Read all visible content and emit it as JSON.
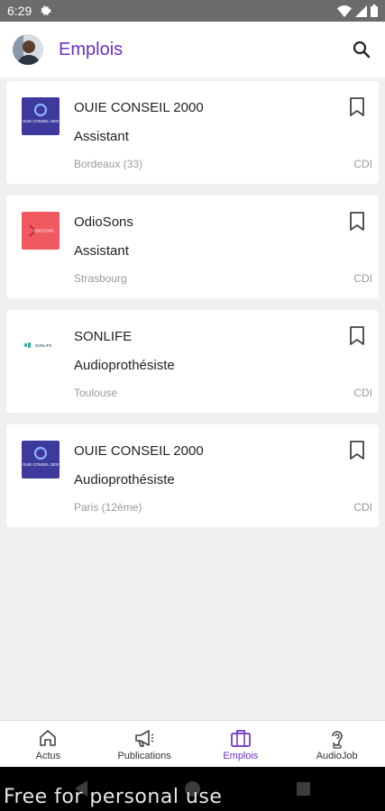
{
  "status_bar": {
    "time": "6:29",
    "icons": [
      "settings-icon",
      "wifi-icon",
      "signal-icon",
      "battery-icon"
    ]
  },
  "app_bar": {
    "title": "Emplois",
    "search_icon": "search-icon",
    "accent_color": "#6a2fc9"
  },
  "jobs": [
    {
      "company": "OUIE CONSEIL 2000",
      "title": "Assistant",
      "location": "Bordeaux (33)",
      "contract": "CDI",
      "logo": {
        "text": "OUIE CONSEIL 2000",
        "bg": "#3d3a9c"
      }
    },
    {
      "company": "OdioSons",
      "title": "Assistant",
      "location": "Strasbourg",
      "contract": "CDI",
      "logo": {
        "text": "ODIOSONS",
        "bg": "#f0595f"
      }
    },
    {
      "company": "SONLIFE",
      "title": "Audioprothésiste",
      "location": "Toulouse",
      "contract": "CDI",
      "logo": {
        "text": "SONLIFE",
        "bg": "#ffffff"
      }
    },
    {
      "company": "OUIE CONSEIL 2000",
      "title": "Audioprothésiste",
      "location": "Paris (12ème)",
      "contract": "CDI",
      "logo": {
        "text": "OUIE CONSEIL 2000",
        "bg": "#3d3a9c"
      }
    }
  ],
  "bottom_nav": {
    "items": [
      {
        "label": "Actus",
        "icon": "home-icon",
        "active": false
      },
      {
        "label": "Publications",
        "icon": "megaphone-icon",
        "active": false
      },
      {
        "label": "Emplois",
        "icon": "briefcase-icon",
        "active": true
      },
      {
        "label": "AudioJob",
        "icon": "ear-icon",
        "active": false
      }
    ]
  },
  "watermark": "Free for personal use"
}
